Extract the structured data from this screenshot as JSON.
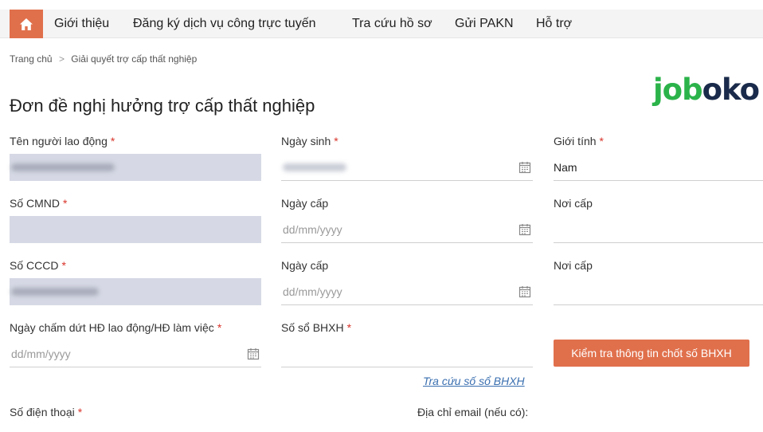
{
  "nav": {
    "home_icon": "home-icon",
    "items": [
      "Giới thiệu",
      "Đăng ký dịch vụ công trực tuyến",
      "Tra cứu hồ sơ",
      "Gửi PAKN",
      "Hỗ trợ"
    ]
  },
  "breadcrumb": {
    "home": "Trang chủ",
    "separator": ">",
    "current": "Giải quyết trợ cấp thất nghiệp"
  },
  "logo": {
    "part1": "job",
    "part2": "oko"
  },
  "page_title": "Đơn đề nghị hưởng trợ cấp thất nghiệp",
  "required_mark": "*",
  "form": {
    "worker_name": {
      "label": "Tên người lao động",
      "value": ""
    },
    "birth_date": {
      "label": "Ngày sinh",
      "value": ""
    },
    "gender": {
      "label": "Giới tính",
      "value": "Nam"
    },
    "id_number": {
      "label": "Số CMND",
      "value": ""
    },
    "id_issue_date": {
      "label": "Ngày cấp",
      "placeholder": "dd/mm/yyyy"
    },
    "id_issue_place": {
      "label": "Nơi cấp",
      "value": ""
    },
    "cccd_number": {
      "label": "Số CCCD",
      "value": ""
    },
    "cccd_issue_date": {
      "label": "Ngày cấp",
      "placeholder": "dd/mm/yyyy"
    },
    "cccd_issue_place": {
      "label": "Nơi cấp",
      "value": ""
    },
    "contract_end_date": {
      "label": "Ngày chấm dứt HĐ lao động/HĐ làm việc",
      "placeholder": "dd/mm/yyyy"
    },
    "social_insurance_number": {
      "label": "Số sổ BHXH",
      "value": ""
    },
    "check_button": "Kiểm tra thông tin chốt số BHXH",
    "lookup_link": "Tra cứu số sổ BHXH",
    "phone": {
      "label": "Số điện thoại"
    },
    "email": {
      "label": "Địa chỉ email (nếu có):"
    }
  },
  "colors": {
    "accent": "#e0704c",
    "filled_field": "#d6d9e5",
    "required": "#d9342b",
    "link": "#3a6fb0",
    "logo_green": "#2bb34a",
    "logo_navy": "#1a2a4a"
  }
}
